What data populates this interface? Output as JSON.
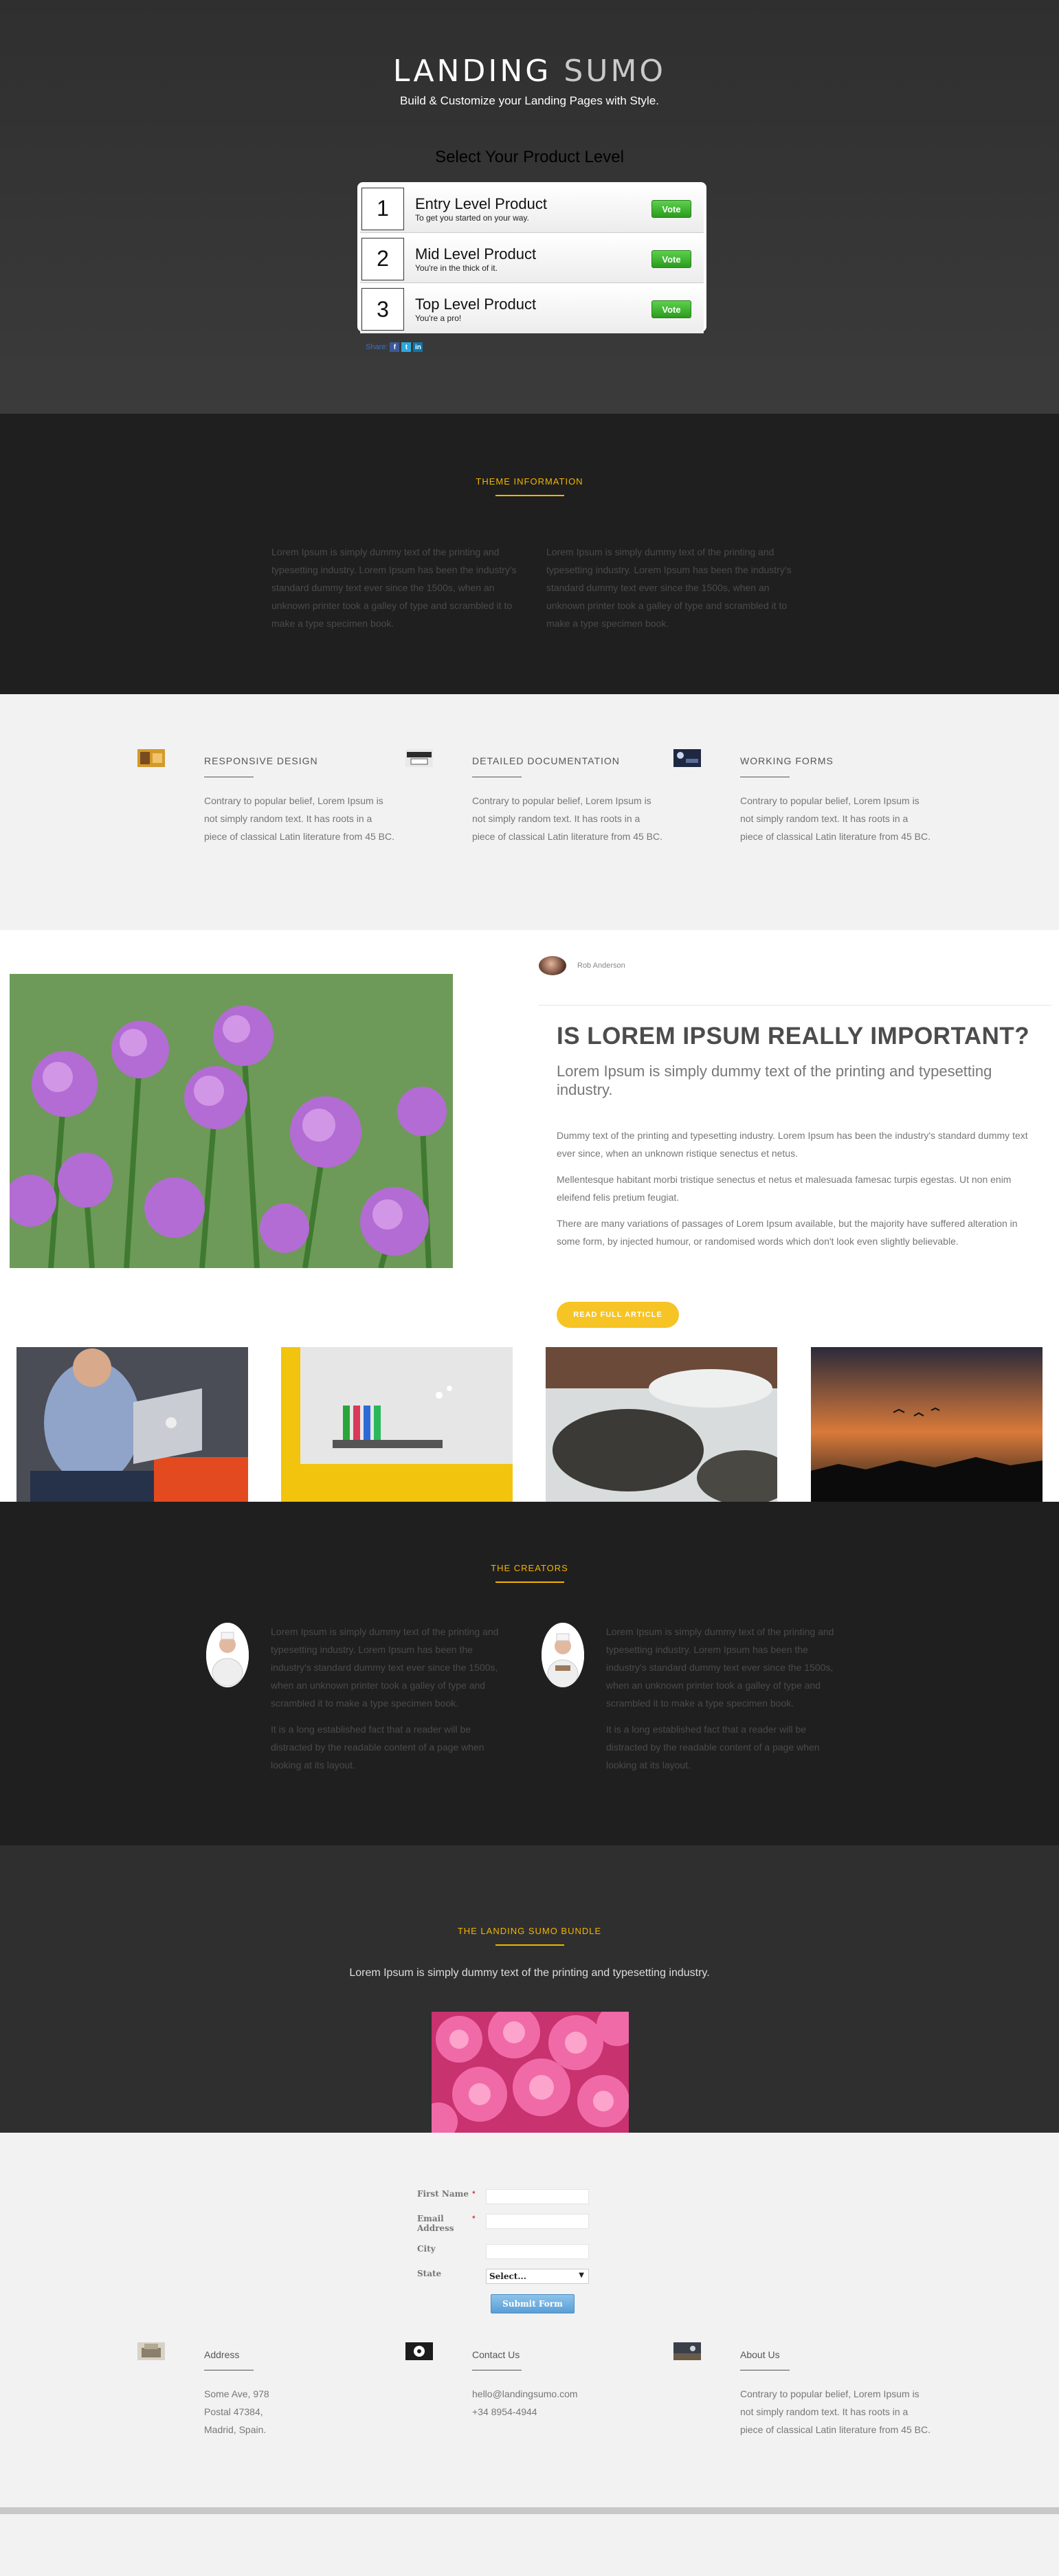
{
  "hero": {
    "logo_part1": "LANDING",
    "logo_part2": "SUMO",
    "tagline": "Build & Customize your Landing Pages with Style.",
    "select_heading": "Select Your Product Level",
    "products": [
      {
        "number": "1",
        "title": "Entry Level Product",
        "subtitle": "To get you started on your way.",
        "vote_label": "Vote"
      },
      {
        "number": "2",
        "title": "Mid Level Product",
        "subtitle": "You're in the thick of it.",
        "vote_label": "Vote"
      },
      {
        "number": "3",
        "title": "Top Level Product",
        "subtitle": "You're a pro!",
        "vote_label": "Vote"
      }
    ],
    "share_label": "Share:"
  },
  "theme": {
    "title": "THEME INFORMATION",
    "col1": "Lorem Ipsum is simply dummy text of the printing and typesetting industry. Lorem Ipsum has been the industry's standard dummy text ever since the 1500s, when an unknown printer took a galley of type and scrambled it to make a type specimen book.",
    "col2": "Lorem Ipsum is simply dummy text of the printing and typesetting industry. Lorem Ipsum has been the industry's standard dummy text ever since the 1500s, when an unknown printer took a galley of type and scrambled it to make a type specimen book."
  },
  "features": [
    {
      "title": "RESPONSIVE DESIGN",
      "text": "Contrary to popular belief, Lorem Ipsum is not simply random text. It has roots in a piece of classical Latin literature from 45 BC."
    },
    {
      "title": "DETAILED DOCUMENTATION",
      "text": "Contrary to popular belief, Lorem Ipsum is not simply random text. It has roots in a piece of classical Latin literature from 45 BC."
    },
    {
      "title": "WORKING FORMS",
      "text": "Contrary to popular belief, Lorem Ipsum is not simply random text. It has roots in a piece of classical Latin literature from 45 BC."
    }
  ],
  "article": {
    "author": "Rob Anderson",
    "title": "IS LOREM IPSUM REALLY IMPORTANT?",
    "subtitle": "Lorem Ipsum is simply dummy text of the printing and typesetting industry.",
    "p1": "Dummy text of the printing and typesetting industry. Lorem Ipsum has been the industry's standard dummy text ever since, when an unknown ristique senectus et netus.",
    "p2": "Mellentesque habitant morbi tristique senectus et netus et malesuada famesac turpis egestas. Ut non enim eleifend felis pretium feugiat.",
    "p3": "There are many variations of passages of Lorem Ipsum available, but the majority have suffered alteration in some form, by injected humour, or randomised words which don't look even slightly believable.",
    "button": "READ FULL ARTICLE"
  },
  "creators": {
    "title": "THE CREATORS",
    "items": [
      {
        "p1": "Lorem Ipsum is simply dummy text of the printing and typesetting industry. Lorem Ipsum has been the industry's standard dummy text ever since the 1500s, when an unknown printer took a galley of type and scrambled it to make a type specimen book.",
        "p2": "It is a long established fact that a reader will be distracted by the readable content of a page when looking at its layout."
      },
      {
        "p1": "Lorem Ipsum is simply dummy text of the printing and typesetting industry. Lorem Ipsum has been the industry's standard dummy text ever since the 1500s, when an unknown printer took a galley of type and scrambled it to make a type specimen book.",
        "p2": "It is a long established fact that a reader will be distracted by the readable content of a page when looking at its layout."
      }
    ]
  },
  "bundle": {
    "title": "THE LANDING SUMO BUNDLE",
    "text": "Lorem Ipsum is simply dummy text of the printing and typesetting industry."
  },
  "form": {
    "first_name_label": "First Name",
    "email_label": "Email Address",
    "city_label": "City",
    "state_label": "State",
    "required_mark": "*",
    "state_value": "Select...",
    "submit_label": "Submit Form"
  },
  "footer": [
    {
      "title": "Address",
      "lines": [
        "Some Ave, 978",
        "Postal 47384,",
        "Madrid, Spain."
      ]
    },
    {
      "title": "Contact Us",
      "lines": [
        "hello@landingsumo.com",
        "+34 8954-4944"
      ]
    },
    {
      "title": "About Us",
      "lines": [
        "Contrary to popular belief, Lorem Ipsum is not simply random text. It has roots in a piece of classical Latin literature from 45 BC."
      ]
    }
  ],
  "colors": {
    "accent": "#f4b400",
    "vote_green": "#3aa829",
    "dark_bg": "#1f1f1f"
  }
}
